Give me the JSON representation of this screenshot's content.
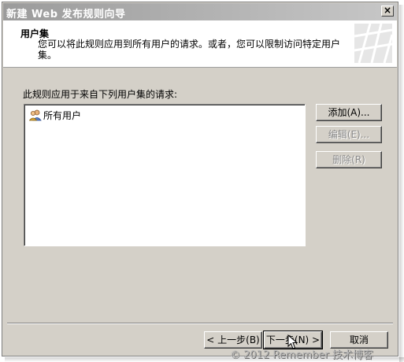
{
  "window": {
    "title": "新建 Web 发布规则向导",
    "close_label": "×"
  },
  "header": {
    "title": "用户集",
    "description": "您可以将此规则应用到所有用户的请求。或者，您可以限制访问特定用户集。"
  },
  "main": {
    "list_label": "此规则应用于来自下列用户集的请求:",
    "list_items": [
      {
        "label": "所有用户",
        "icon": "user-group-icon"
      }
    ],
    "buttons": {
      "add": "添加(A)...",
      "edit": "编辑(E)...",
      "delete": "删除(R)"
    }
  },
  "footer": {
    "back": "< 上一步(B)",
    "next": "下一步(N) >",
    "cancel": "取消"
  },
  "watermark": "© 2012 Remember 技术博客"
}
